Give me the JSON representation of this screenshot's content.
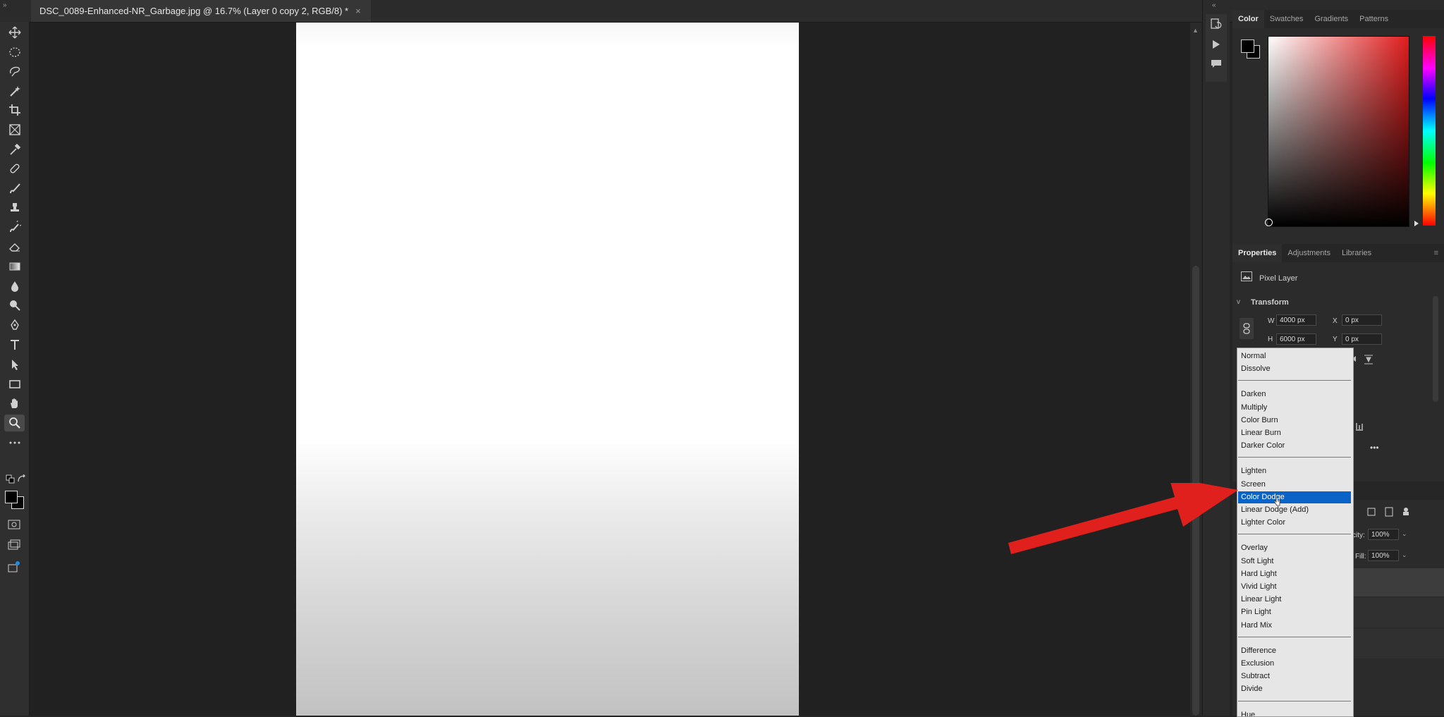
{
  "window": {
    "document_tab_title": "DSC_0089-Enhanced-NR_Garbage.jpg @ 16.7% (Layer 0 copy 2, RGB/8) *",
    "close_glyph": "×",
    "collapse_left_glyph": "»",
    "collapse_right_glyph": "«"
  },
  "toolbar": {
    "tools": [
      "move-icon",
      "marquee-icon",
      "lasso-icon",
      "magic-wand-icon",
      "crop-icon",
      "frame-icon",
      "eyedropper-icon",
      "healing-icon",
      "brush-icon",
      "stamp-icon",
      "history-brush-icon",
      "eraser-icon",
      "gradient-icon",
      "blur-icon",
      "dodge-icon",
      "pen-icon",
      "type-icon",
      "path-select-icon",
      "rectangle-icon",
      "hand-icon",
      "zoom-icon",
      "more-icon"
    ],
    "active_tool": "zoom-icon",
    "foreground_color": "#000000",
    "background_color": "#000000"
  },
  "color_panel": {
    "tabs": [
      "Color",
      "Swatches",
      "Gradients",
      "Patterns"
    ],
    "active_tab": "Color",
    "hue_color": "#e11c1c"
  },
  "properties_panel": {
    "tabs": [
      "Properties",
      "Adjustments",
      "Libraries"
    ],
    "active_tab": "Properties",
    "layer_kind": "Pixel Layer",
    "transform_title": "Transform",
    "w_label": "W",
    "w_value": "4000 px",
    "h_label": "H",
    "h_value": "6000 px",
    "x_label": "X",
    "x_value": "0 px",
    "y_label": "Y",
    "y_value": "0 px"
  },
  "layers_panel": {
    "opacity_label_partial": "city:",
    "opacity_value": "100%",
    "fill_label": "Fill:",
    "fill_value": "100%"
  },
  "blend_mode_menu": {
    "selected": "Color Dodge",
    "groups": [
      [
        "Normal",
        "Dissolve"
      ],
      [
        "Darken",
        "Multiply",
        "Color Burn",
        "Linear Burn",
        "Darker Color"
      ],
      [
        "Lighten",
        "Screen",
        "Color Dodge",
        "Linear Dodge (Add)",
        "Lighter Color"
      ],
      [
        "Overlay",
        "Soft Light",
        "Hard Light",
        "Vivid Light",
        "Linear Light",
        "Pin Light",
        "Hard Mix"
      ],
      [
        "Difference",
        "Exclusion",
        "Subtract",
        "Divide"
      ],
      [
        "Hue"
      ]
    ]
  },
  "annotation": {
    "arrow_color": "#e0201c"
  }
}
